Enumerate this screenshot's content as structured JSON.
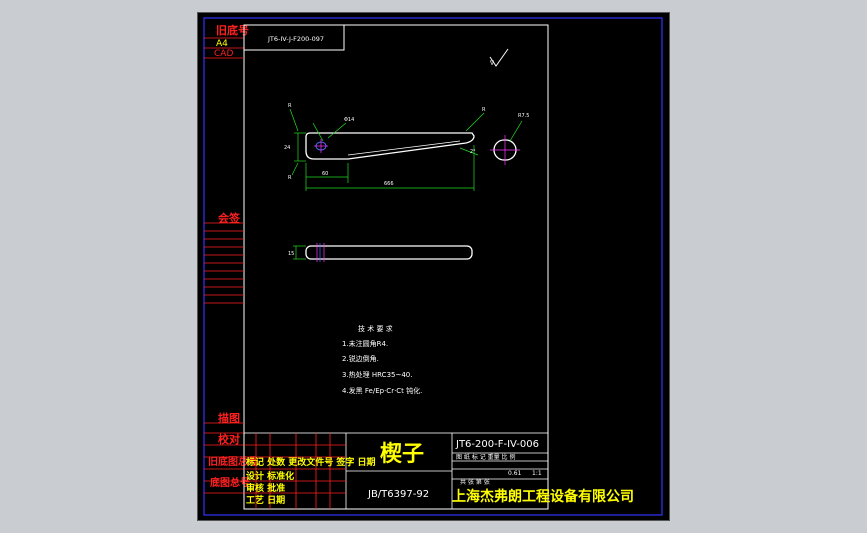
{
  "colors": {
    "window_bg": "#c9ccd1",
    "viewport_bg": "#000000",
    "frame": "#ffffff",
    "outer_frame": "#3333ff",
    "label_red": "#ff2020",
    "line_red": "#ff2020",
    "title_yellow": "#ffff00",
    "dim_green": "#22dd22",
    "centerline_magenta": "#ff33ff",
    "blue_line": "#4b6bff"
  },
  "left_strip": {
    "archive_no": "旧底号",
    "paper_size": "A4",
    "cad": "CAD",
    "signature": "会签",
    "description": "描图",
    "proofread": "校对",
    "old_drawing_total": "旧底图总号",
    "base_drawing_total": "底图总号"
  },
  "top_box_code": "JT6-IV-J-F200-097",
  "technical_requirements": {
    "heading": "技 术 要 求",
    "items": [
      "1.未注圆角R4.",
      "2.锐边倒角.",
      "3.热处理 HRC35~40.",
      "4.发黑 Fe/Ep·Cr·Ct 钝化."
    ]
  },
  "title_block": {
    "part_name": "楔子",
    "drawing_no": "JT6-200-F-IV-006",
    "standard": "JB/T6397-92",
    "row_labels": "图 纸 标 记 重量 比 例",
    "qty": "0.61",
    "scale": "1:1",
    "sheet_info": "共 张 第 张",
    "company": "上海杰弗朗工程设备有限公司",
    "sign_rows": [
      "标记 处数 更改文件号 签字 日期",
      "设计 标准化",
      "审核 批准",
      "工艺 日期"
    ]
  },
  "dimensions": {
    "overall_length": "666",
    "slot_offset": "60",
    "hole_dia": "Φ14",
    "angle": "2°",
    "side_height": "24",
    "detail_label": "R7.5",
    "thickness": "15"
  }
}
